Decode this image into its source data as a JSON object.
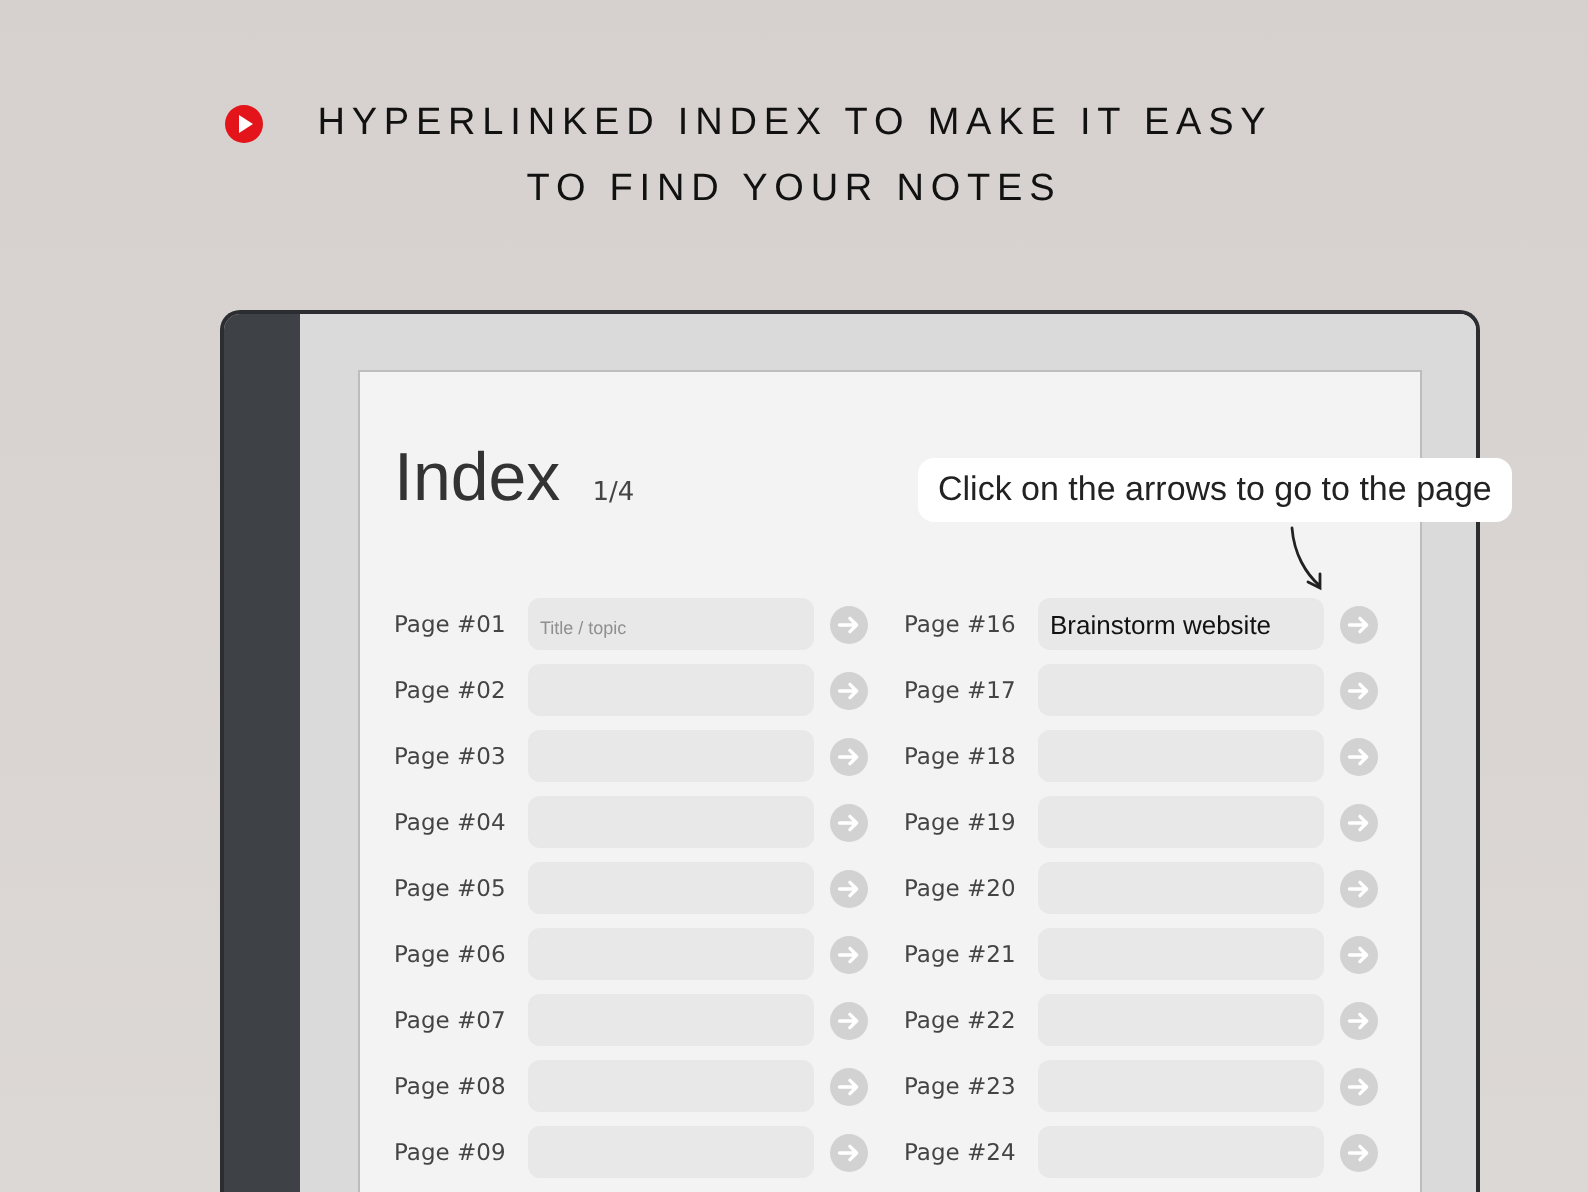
{
  "headline": [
    "HYPERLINKED INDEX TO MAKE IT EASY",
    "TO FIND YOUR NOTES"
  ],
  "page": {
    "title": "Index",
    "page_indicator": "1/4"
  },
  "callout": "Click on the arrows to go to the page",
  "columns": [
    {
      "entries": [
        {
          "label": "Page #01",
          "placeholder": "Title / topic"
        },
        {
          "label": "Page #02"
        },
        {
          "label": "Page #03"
        },
        {
          "label": "Page #04"
        },
        {
          "label": "Page #05"
        },
        {
          "label": "Page #06"
        },
        {
          "label": "Page #07"
        },
        {
          "label": "Page #08"
        },
        {
          "label": "Page #09"
        }
      ]
    },
    {
      "entries": [
        {
          "label": "Page #16",
          "value": "Brainstorm website"
        },
        {
          "label": "Page #17"
        },
        {
          "label": "Page #18"
        },
        {
          "label": "Page #19"
        },
        {
          "label": "Page #20"
        },
        {
          "label": "Page #21"
        },
        {
          "label": "Page #22"
        },
        {
          "label": "Page #23"
        },
        {
          "label": "Page #24"
        }
      ]
    }
  ]
}
